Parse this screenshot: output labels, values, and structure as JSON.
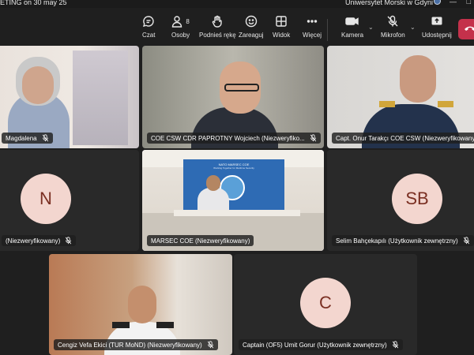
{
  "window": {
    "title": "ETING on 30 may 25",
    "org_name": "Uniwersytet Morski w Gdyni",
    "min_label": "—",
    "max_label": "□"
  },
  "toolbar": {
    "chat": "Czat",
    "people": "Osoby",
    "people_count": "8",
    "raise_hand": "Podnieś rękę",
    "react": "Zareaguj",
    "view": "Widok",
    "more": "Więcej",
    "camera": "Kamera",
    "mic": "Mikrofon",
    "share": "Udostępnij",
    "caret": "⌄"
  },
  "participants": [
    {
      "name": "Magdalena",
      "type": "video"
    },
    {
      "name": "COE CSW CDR PAPROTNY Wojciech (Niezweryfiko...",
      "type": "video"
    },
    {
      "name": "Capt. Onur Tarakçı COE CSW (Niezweryfikowany)",
      "type": "video"
    },
    {
      "name": "(Niezweryfikowany)",
      "type": "avatar",
      "initials": "N"
    },
    {
      "name": "MARSEC COE (Niezweryfikowany)",
      "type": "video",
      "active": true
    },
    {
      "name": "Selim Bahçekapılı (Użytkownik zewnętrzny)",
      "type": "avatar",
      "initials": "SB"
    },
    {
      "name": "Cengiz Vefa Ekici (TUR MoND) (Niezweryfikowany)",
      "type": "video"
    },
    {
      "name": "Captain (OF5) Umit Gorur (Użytkownik zewnętrzny)",
      "type": "avatar",
      "initials": "C"
    }
  ],
  "banner": {
    "line1": "NATO MARSEC COE",
    "line2": "Working Together for Maritime Security"
  },
  "colors": {
    "background": "#1f1f1f",
    "tile": "#292929",
    "avatar_bg": "#f3d6cf",
    "avatar_fg": "#7a2f22",
    "hangup": "#c4314b",
    "active_outline": "#8f8fe6"
  }
}
